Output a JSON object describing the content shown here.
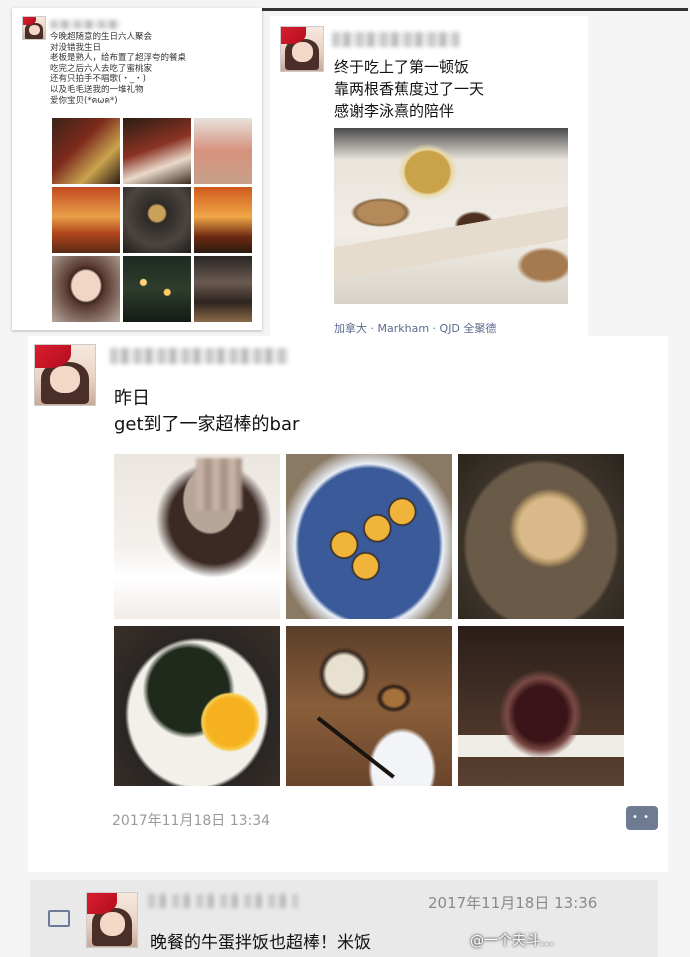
{
  "post1": {
    "lines": [
      "今晚超随意的生日六人聚会",
      "对没错我生日",
      "老板是熟人，给布置了超浮夸的餐桌",
      "吃完之后六人去吃了蜜桃家",
      "还有只拍手不唱歌(・_・)",
      "以及毛毛送我的一堆礼物",
      "爱你宝贝(*ฅωฅ*)"
    ]
  },
  "post2": {
    "lines": [
      "终于吃上了第一顿饭",
      "靠两根香蕉度过了一天",
      "感谢李泳熹的陪伴"
    ],
    "location": "加拿大 · Markham · QJD 全聚德"
  },
  "post3": {
    "line1": "昨日",
    "line2": "get到了一家超棒的bar",
    "timestamp": "2017年11月18日 13:34"
  },
  "post4": {
    "timestamp": "2017年11月18日 13:36",
    "text": "晚餐的牛蛋拌饭也超棒！米饭"
  },
  "watermark": "@一个夫斗…"
}
